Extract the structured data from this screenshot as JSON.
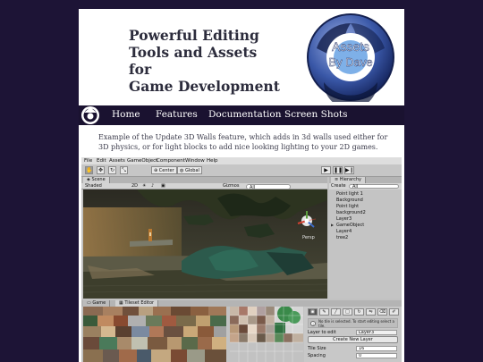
{
  "header": {
    "tagline_lines": [
      "Powerful Editing",
      "Tools and Assets for",
      "Game Development"
    ],
    "logo_lines": [
      "Assets",
      "By Dave"
    ]
  },
  "nav": {
    "items": [
      "Home",
      "Features",
      "Documentation",
      "Screen Shots"
    ]
  },
  "content": {
    "caption": "Example of the Update 3D Walls feature, which adds in 3d walls used either for 3D physics, or for light blocks to add nice looking lighting to your 2D games."
  },
  "unity": {
    "menu": [
      "File",
      "Edit",
      "Assets",
      "GameObject",
      "Component",
      "Window",
      "Help"
    ],
    "toolbar": {
      "tools": [
        "hand",
        "move",
        "rotate",
        "scale"
      ],
      "pivot_label": "Center",
      "space_label": "Global"
    },
    "scene": {
      "tab": "Scene",
      "shading": "Shaded",
      "mode": "2D",
      "gizmos": "Gizmos",
      "gizmo_search": "All",
      "persp": "Persp"
    },
    "hierarchy": {
      "tab": "Hierarchy",
      "create": "Create",
      "search": "All",
      "items": [
        "Point light 1",
        "Background",
        "Point light",
        "background2",
        "Layer3",
        "GameObject",
        "Layer4",
        "tree2"
      ]
    },
    "bottom_tabs": [
      "Game",
      "Tileset Editor"
    ],
    "tileset_tools": {
      "info": "No tile is selected. To start editing select a tile.",
      "layer_to_edit_label": "Layer to edit",
      "layer_value": "Layer3",
      "create_layer": "Create New Layer",
      "tile_size_label": "Tile Size",
      "tile_size_value": "16",
      "spacing_label": "Spacing",
      "spacing_value": "0"
    }
  }
}
